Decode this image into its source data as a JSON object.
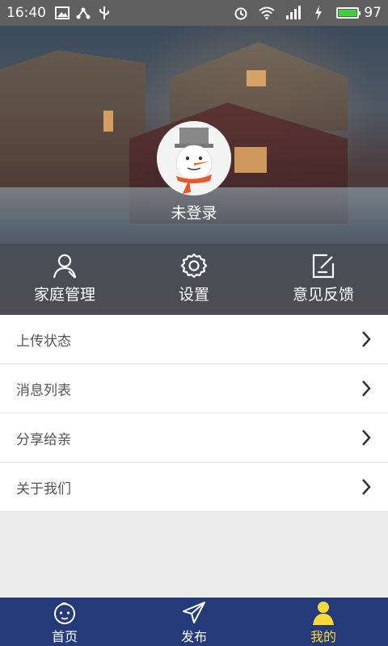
{
  "status_bar": {
    "time": "16:40",
    "battery": "97",
    "network": "4G"
  },
  "profile": {
    "login_label": "未登录"
  },
  "quick_actions": [
    {
      "label": "家庭管理",
      "icon": "user-icon"
    },
    {
      "label": "设置",
      "icon": "gear-icon"
    },
    {
      "label": "意见反馈",
      "icon": "edit-icon"
    }
  ],
  "menu": [
    {
      "label": "上传状态"
    },
    {
      "label": "消息列表"
    },
    {
      "label": "分享给亲"
    },
    {
      "label": "关于我们"
    }
  ],
  "tabbar": {
    "active_color": "#ffd83a",
    "background": "#243a79",
    "tabs": [
      {
        "label": "首页",
        "icon": "baby-face-icon"
      },
      {
        "label": "发布",
        "icon": "send-icon"
      },
      {
        "label": "我的",
        "icon": "person-icon"
      }
    ]
  }
}
